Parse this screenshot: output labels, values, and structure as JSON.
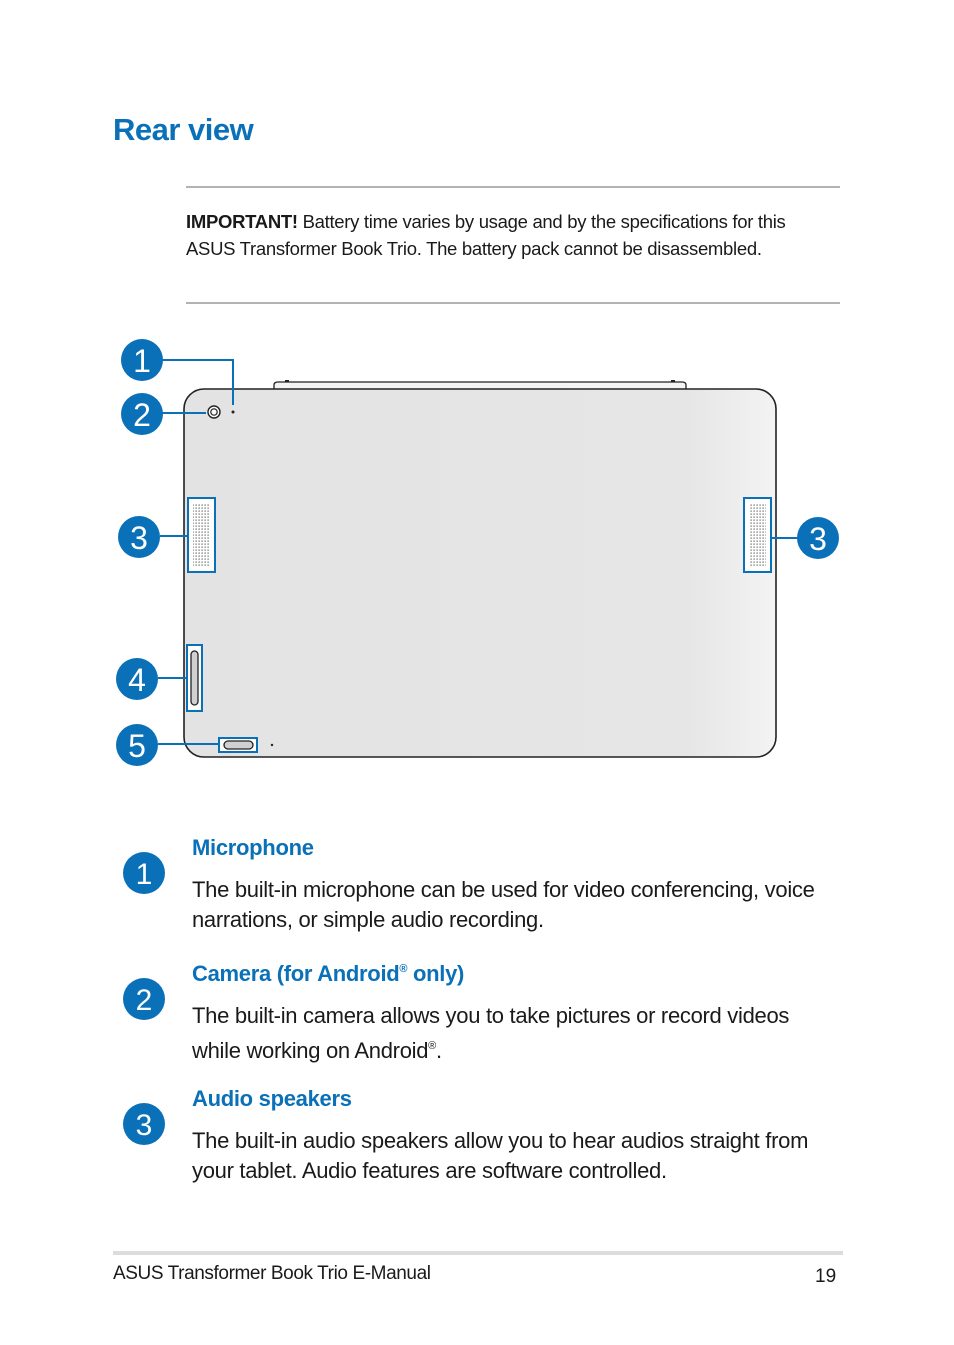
{
  "page": {
    "title": "Rear view",
    "accent_color": "#0a70b8"
  },
  "note": {
    "label": "IMPORTANT!",
    "text": " Battery time varies by usage and by the specifications for this ASUS Transformer Book Trio. The battery pack cannot be disassembled."
  },
  "diagram": {
    "callouts": [
      {
        "number": "1",
        "target": "microphone"
      },
      {
        "number": "2",
        "target": "camera"
      },
      {
        "number": "3",
        "target": "left-speaker"
      },
      {
        "number": "3",
        "target": "right-speaker"
      },
      {
        "number": "4",
        "target": "side-slot"
      },
      {
        "number": "5",
        "target": "bottom-port"
      }
    ]
  },
  "items": [
    {
      "number": "1",
      "heading": "Microphone",
      "heading_sup": "",
      "heading_tail": "",
      "description": "The built-in microphone can be used for video conferencing, voice narrations, or simple audio recording.",
      "desc_sup": "",
      "desc_tail": ""
    },
    {
      "number": "2",
      "heading": "Camera (for Android",
      "heading_sup": "®",
      "heading_tail": " only)",
      "description": "The built-in camera allows you to take pictures or record videos while working on Android",
      "desc_sup": "®",
      "desc_tail": "."
    },
    {
      "number": "3",
      "heading": "Audio speakers",
      "heading_sup": "",
      "heading_tail": "",
      "description": "The built-in audio speakers allow you to hear audios straight from your tablet. Audio features are software controlled.",
      "desc_sup": "",
      "desc_tail": ""
    }
  ],
  "footer": {
    "manual_title": "ASUS Transformer Book Trio E-Manual",
    "page_number": "19"
  }
}
